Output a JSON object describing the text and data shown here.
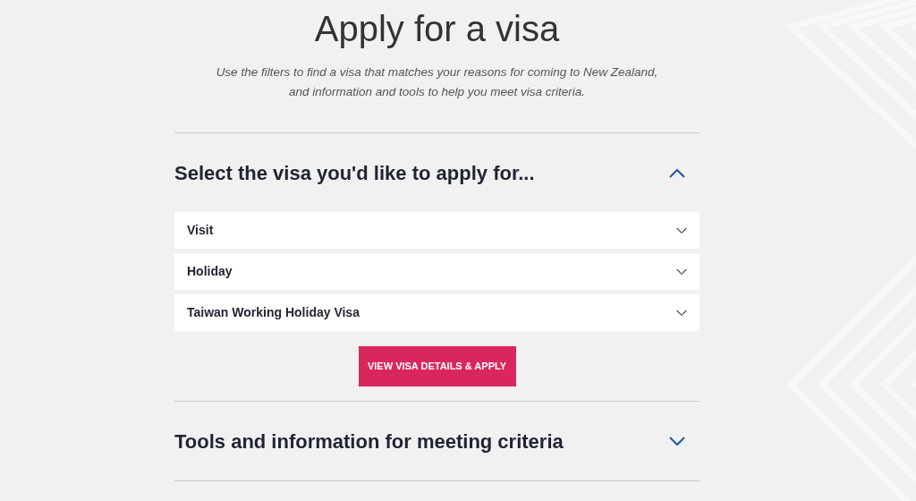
{
  "page": {
    "title": "Apply for a visa",
    "intro": "Use the filters to find a visa that matches your reasons for coming to New Zealand, and information and tools to help you meet visa criteria."
  },
  "sections": [
    {
      "title": "Select the visa you'd like to apply for...",
      "expanded": true,
      "selects": [
        {
          "label": "Visit"
        },
        {
          "label": "Holiday"
        },
        {
          "label": "Taiwan Working Holiday Visa"
        }
      ],
      "button": "VIEW VISA DETAILS & APPLY"
    },
    {
      "title": "Tools and information for meeting criteria",
      "expanded": false
    }
  ]
}
